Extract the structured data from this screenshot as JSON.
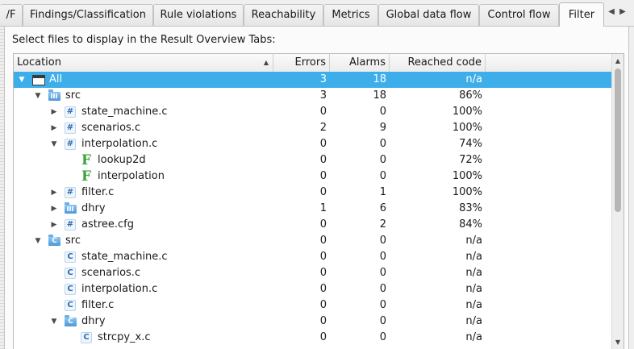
{
  "tabs": [
    {
      "label": "/F",
      "active": false
    },
    {
      "label": "Findings/Classification",
      "active": false
    },
    {
      "label": "Rule violations",
      "active": false
    },
    {
      "label": "Reachability",
      "active": false
    },
    {
      "label": "Metrics",
      "active": false
    },
    {
      "label": "Global data flow",
      "active": false
    },
    {
      "label": "Control flow",
      "active": false
    },
    {
      "label": "Filter",
      "active": true
    }
  ],
  "tab_scroll": {
    "left": "◀",
    "right": "▶"
  },
  "panel_label": "Select files to display in the Result Overview Tabs:",
  "columns": {
    "location": "Location",
    "errors": "Errors",
    "alarms": "Alarms",
    "reached": "Reached code",
    "sort_indicator": "▲"
  },
  "rows": [
    {
      "label": "All",
      "icon": "window-icon",
      "level": 0,
      "expander": "expanded",
      "errors": "3",
      "alarms": "18",
      "reached": "n/a",
      "selected": true
    },
    {
      "label": "src",
      "icon": "folder-icon",
      "level": 1,
      "expander": "expanded",
      "errors": "3",
      "alarms": "18",
      "reached": "86%"
    },
    {
      "label": "state_machine.c",
      "icon": "hash-file-icon",
      "level": 2,
      "expander": "collapsed",
      "errors": "0",
      "alarms": "0",
      "reached": "100%"
    },
    {
      "label": "scenarios.c",
      "icon": "hash-file-icon",
      "level": 2,
      "expander": "collapsed",
      "errors": "2",
      "alarms": "9",
      "reached": "100%"
    },
    {
      "label": "interpolation.c",
      "icon": "hash-file-icon",
      "level": 2,
      "expander": "expanded",
      "errors": "0",
      "alarms": "0",
      "reached": "74%"
    },
    {
      "label": "lookup2d",
      "icon": "function-icon",
      "level": 3,
      "expander": "none",
      "errors": "0",
      "alarms": "0",
      "reached": "72%"
    },
    {
      "label": "interpolation",
      "icon": "function-icon",
      "level": 3,
      "expander": "none",
      "errors": "0",
      "alarms": "0",
      "reached": "100%"
    },
    {
      "label": "filter.c",
      "icon": "hash-file-icon",
      "level": 2,
      "expander": "collapsed",
      "errors": "0",
      "alarms": "1",
      "reached": "100%"
    },
    {
      "label": "dhry",
      "icon": "folder-icon",
      "level": 2,
      "expander": "collapsed",
      "errors": "1",
      "alarms": "6",
      "reached": "83%"
    },
    {
      "label": "astree.cfg",
      "icon": "hash-file-icon",
      "level": 2,
      "expander": "collapsed",
      "errors": "0",
      "alarms": "2",
      "reached": "84%"
    },
    {
      "label": "src",
      "icon": "c-folder-icon",
      "level": 1,
      "expander": "expanded",
      "errors": "0",
      "alarms": "0",
      "reached": "n/a"
    },
    {
      "label": "state_machine.c",
      "icon": "c-file-icon",
      "level": 2,
      "expander": "none",
      "errors": "0",
      "alarms": "0",
      "reached": "n/a"
    },
    {
      "label": "scenarios.c",
      "icon": "c-file-icon",
      "level": 2,
      "expander": "none",
      "errors": "0",
      "alarms": "0",
      "reached": "n/a"
    },
    {
      "label": "interpolation.c",
      "icon": "c-file-icon",
      "level": 2,
      "expander": "none",
      "errors": "0",
      "alarms": "0",
      "reached": "n/a"
    },
    {
      "label": "filter.c",
      "icon": "c-file-icon",
      "level": 2,
      "expander": "none",
      "errors": "0",
      "alarms": "0",
      "reached": "n/a"
    },
    {
      "label": "dhry",
      "icon": "c-folder-icon",
      "level": 2,
      "expander": "expanded",
      "errors": "0",
      "alarms": "0",
      "reached": "n/a"
    },
    {
      "label": "strcpy_x.c",
      "icon": "c-file-icon",
      "level": 3,
      "expander": "none",
      "errors": "0",
      "alarms": "0",
      "reached": "n/a"
    }
  ],
  "icon_glyphs": {
    "hash": "#",
    "c": "C",
    "function": "F"
  },
  "colors": {
    "selection": "#3daee9",
    "function_icon": "#3aa13a",
    "file_icon": "#2b6db1"
  }
}
